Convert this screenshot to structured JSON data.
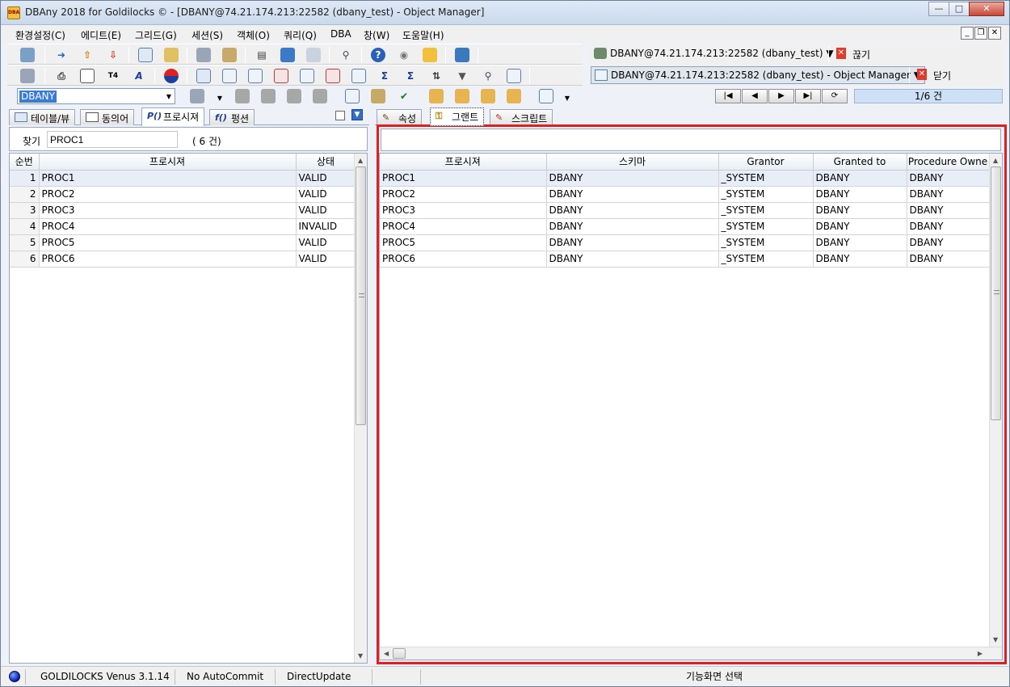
{
  "window": {
    "title": "DBAny 2018 for Goldilocks © - [DBANY@74.21.174.213:22582 (dbany_test) - Object Manager]",
    "app_icon_text": "DBA"
  },
  "menu": [
    {
      "label": "환경설정(C)"
    },
    {
      "label": "에디트(E)"
    },
    {
      "label": "그리드(G)"
    },
    {
      "label": "세션(S)"
    },
    {
      "label": "객체(O)"
    },
    {
      "label": "쿼리(Q)"
    },
    {
      "label": "DBA"
    },
    {
      "label": "창(W)"
    },
    {
      "label": "도움말(H)"
    }
  ],
  "connections": {
    "connection_label": "DBANY@74.21.174.213:22582 (dbany_test) ▼",
    "disconnect_label": "끊기",
    "window_label": "DBANY@74.21.174.213:22582 (dbany_test) - Object Manager ▼",
    "close_label": "닫기"
  },
  "schema_combo": {
    "value": "DBANY"
  },
  "navigator": {
    "count": "1/6 건"
  },
  "left_tabs": [
    {
      "label": "테이블/뷰",
      "icon": "table-icon"
    },
    {
      "label": "동의어",
      "icon": "synonym-icon"
    },
    {
      "label": "프로시져",
      "icon": "procedure-icon",
      "icon_text": "P()",
      "active": true
    },
    {
      "label": "펑션",
      "icon": "function-icon",
      "icon_text": "f()"
    }
  ],
  "find": {
    "label": "찾기",
    "value": "PROC1",
    "count": "( 6 건)"
  },
  "procedure_list": {
    "headers": [
      "순번",
      "프로시져",
      "상태"
    ],
    "rows": [
      {
        "no": "1",
        "name": "PROC1",
        "status": "VALID"
      },
      {
        "no": "2",
        "name": "PROC2",
        "status": "VALID"
      },
      {
        "no": "3",
        "name": "PROC3",
        "status": "VALID"
      },
      {
        "no": "4",
        "name": "PROC4",
        "status": "INVALID"
      },
      {
        "no": "5",
        "name": "PROC5",
        "status": "VALID"
      },
      {
        "no": "6",
        "name": "PROC6",
        "status": "VALID"
      }
    ]
  },
  "right_tabs": [
    {
      "label": "속성",
      "icon": "properties-icon"
    },
    {
      "label": "그랜트",
      "icon": "key-icon",
      "active": true
    },
    {
      "label": "스크립트",
      "icon": "script-icon"
    }
  ],
  "grant_grid": {
    "headers": [
      "프로시져",
      "스키마",
      "Grantor",
      "Granted to",
      "Procedure Owne"
    ],
    "rows": [
      [
        "PROC1",
        "DBANY",
        "_SYSTEM",
        "DBANY",
        "DBANY"
      ],
      [
        "PROC2",
        "DBANY",
        "_SYSTEM",
        "DBANY",
        "DBANY"
      ],
      [
        "PROC3",
        "DBANY",
        "_SYSTEM",
        "DBANY",
        "DBANY"
      ],
      [
        "PROC4",
        "DBANY",
        "_SYSTEM",
        "DBANY",
        "DBANY"
      ],
      [
        "PROC5",
        "DBANY",
        "_SYSTEM",
        "DBANY",
        "DBANY"
      ],
      [
        "PROC6",
        "DBANY",
        "_SYSTEM",
        "DBANY",
        "DBANY"
      ]
    ]
  },
  "status": {
    "product": "GOLDILOCKS Venus 3.1.14",
    "commit": "No AutoCommit",
    "update_mode": "DirectUpdate",
    "message": "기능화면 선택"
  },
  "colors": {
    "highlight": "#e02020",
    "selection": "#3a7bd5"
  }
}
